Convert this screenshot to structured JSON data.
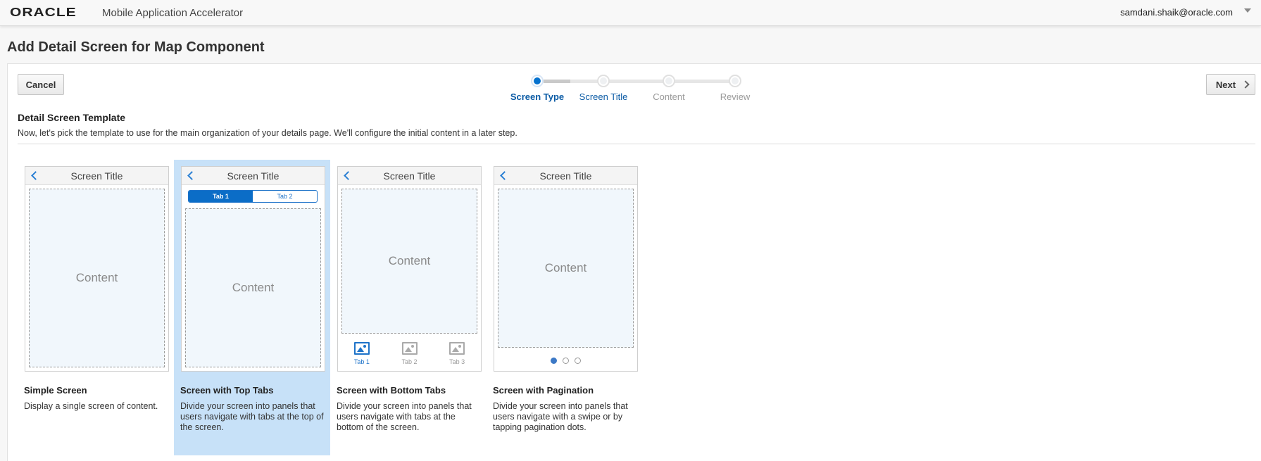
{
  "header": {
    "logo": "ORACLE",
    "app_name": "Mobile Application Accelerator",
    "user": "samdani.shaik@oracle.com"
  },
  "page_title": "Add Detail Screen for Map Component",
  "buttons": {
    "cancel": "Cancel",
    "next": "Next"
  },
  "train": {
    "steps": [
      {
        "label": "Screen Type",
        "state": "current"
      },
      {
        "label": "Screen Title",
        "state": "visited"
      },
      {
        "label": "Content",
        "state": "unvisited"
      },
      {
        "label": "Review",
        "state": "unvisited"
      }
    ]
  },
  "section": {
    "title": "Detail Screen Template",
    "description": "Now, let's pick the template to use for the main organization of your details page. We'll configure the initial content in a later step."
  },
  "templates": [
    {
      "screen_title": "Screen Title",
      "content_label": "Content",
      "name": "Simple Screen",
      "description": "Display a single screen of content.",
      "selected": false
    },
    {
      "screen_title": "Screen Title",
      "content_label": "Content",
      "tabs": [
        "Tab 1",
        "Tab 2"
      ],
      "name": "Screen with Top Tabs",
      "description": "Divide your screen into panels that users navigate with tabs at the top of the screen.",
      "selected": true
    },
    {
      "screen_title": "Screen Title",
      "content_label": "Content",
      "tabs": [
        "Tab 1",
        "Tab 2",
        "Tab 3"
      ],
      "name": "Screen with Bottom Tabs",
      "description": "Divide your screen into panels that users navigate with tabs at the bottom of the screen.",
      "selected": false
    },
    {
      "screen_title": "Screen Title",
      "content_label": "Content",
      "page_count": 3,
      "current_page": 1,
      "name": "Screen with Pagination",
      "description": "Divide your screen into panels that users navigate with a swipe or by tapping pagination dots.",
      "selected": false
    }
  ],
  "colors": {
    "accent": "#0572ce",
    "selected_card": "#c7e1f8",
    "content_fill": "#f1f7fc"
  }
}
